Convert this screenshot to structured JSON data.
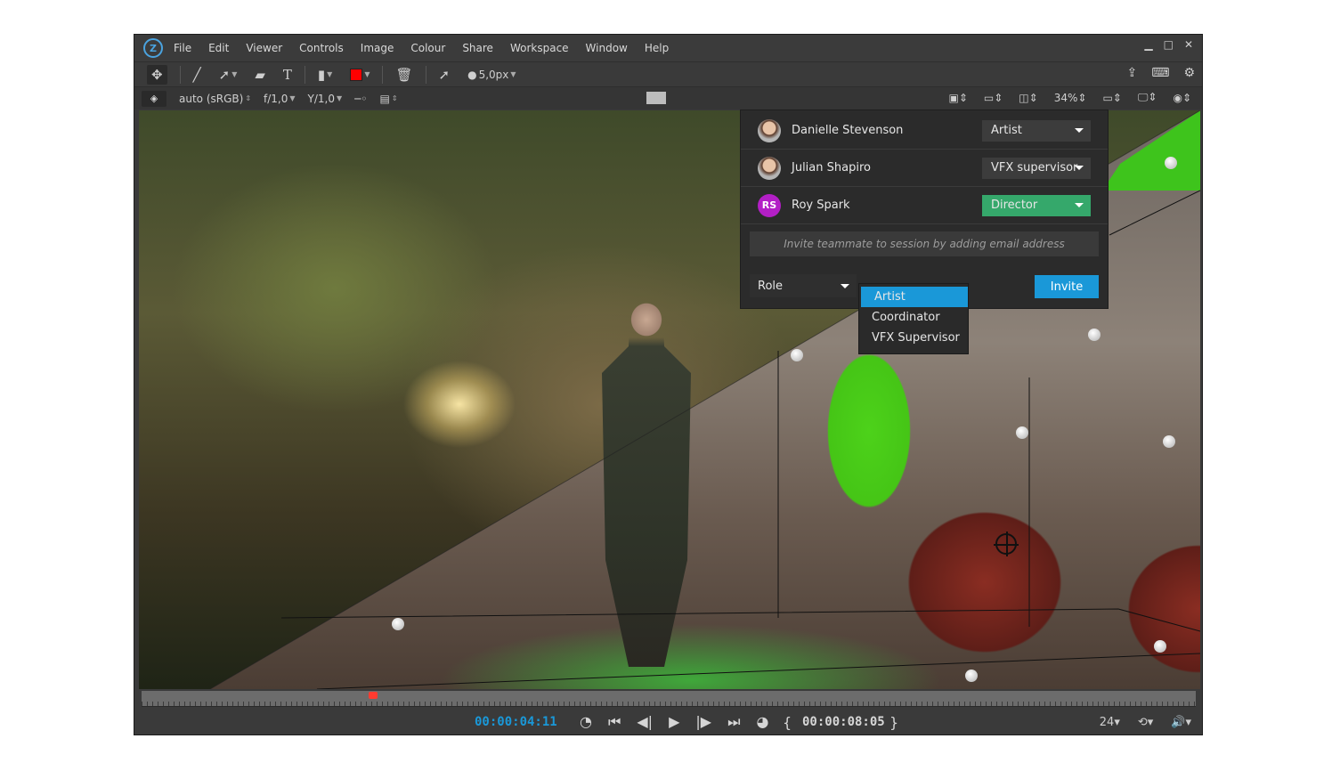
{
  "menu": [
    "File",
    "Edit",
    "Viewer",
    "Controls",
    "Image",
    "Colour",
    "Share",
    "Workspace",
    "Window",
    "Help"
  ],
  "logo": "Z",
  "window_controls": {
    "minimize": "▁",
    "maximize": "□",
    "close": "✕"
  },
  "toolbar": {
    "brush_size": "5,0px",
    "color": "#ff0000"
  },
  "viewer_bar": {
    "color_space": "auto (sRGB)",
    "fstop": "f/1,0",
    "gamma": "Y/1,0",
    "zoom": "34%"
  },
  "session": {
    "users": [
      {
        "name": "Danielle Stevenson",
        "role": "Artist",
        "initials": ""
      },
      {
        "name": "Julian Shapiro",
        "role": "VFX supervisor",
        "initials": ""
      },
      {
        "name": "Roy Spark",
        "role": "Director",
        "initials": "RS"
      }
    ],
    "invite_placeholder": "Invite teammate to session by adding email address",
    "role_label": "Role",
    "invite_button": "Invite",
    "role_options": [
      "Artist",
      "Coordinator",
      "VFX Supervisor"
    ],
    "selected_option": "Artist"
  },
  "transport": {
    "current_time": "00:00:04:11",
    "duration": "00:00:08:05",
    "fps": "24",
    "playhead_fraction": 0.215
  },
  "colors": {
    "accent": "#1a98d8",
    "director": "#35a86b",
    "roy_avatar": "#b31fc6",
    "playhead": "#ff3b30"
  }
}
